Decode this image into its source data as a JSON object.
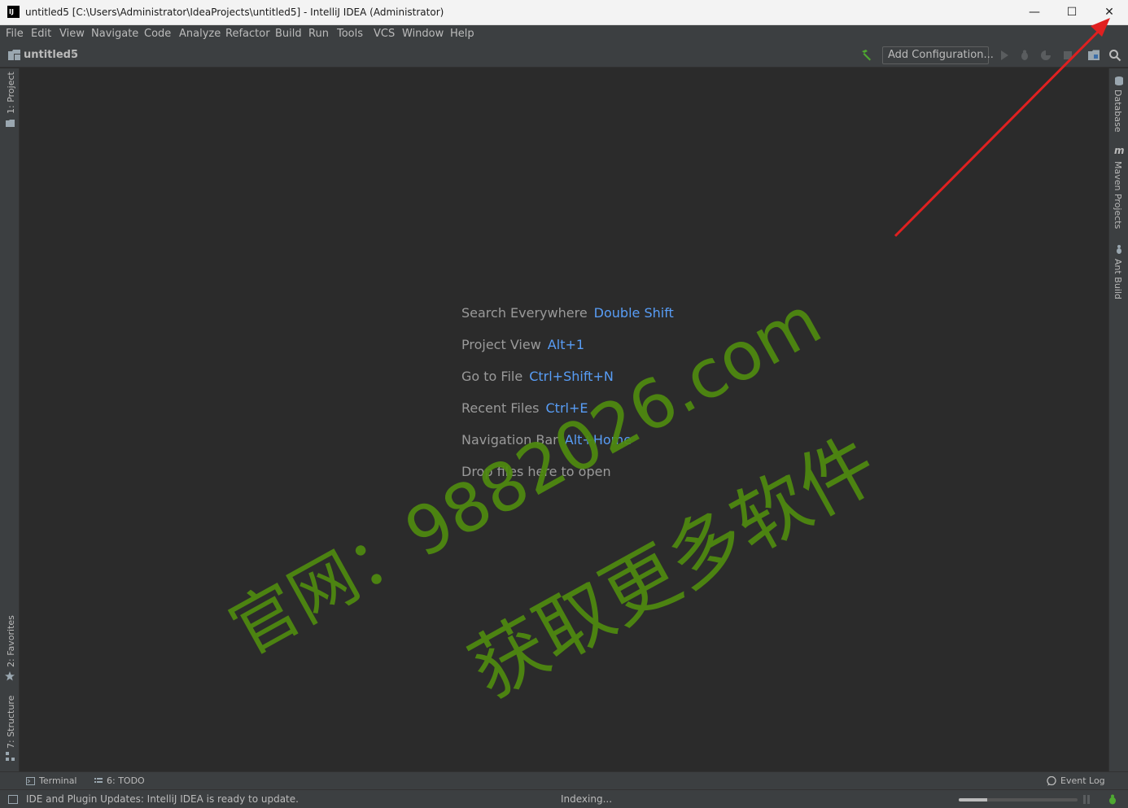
{
  "window": {
    "title": "untitled5 [C:\\Users\\Administrator\\IdeaProjects\\untitled5] - IntelliJ IDEA (Administrator)",
    "app_icon_text": "IJ",
    "controls": {
      "minimize": "—",
      "maximize": "☐",
      "close": "✕"
    }
  },
  "menu": [
    {
      "label": "File"
    },
    {
      "label": "Edit"
    },
    {
      "label": "View"
    },
    {
      "label": "Navigate"
    },
    {
      "label": "Code"
    },
    {
      "label": "Analyze"
    },
    {
      "label": "Refactor"
    },
    {
      "label": "Build"
    },
    {
      "label": "Run"
    },
    {
      "label": "Tools"
    },
    {
      "label": "VCS"
    },
    {
      "label": "Window"
    },
    {
      "label": "Help"
    }
  ],
  "navbar": {
    "project": "untitled5",
    "arrow": "›",
    "add_configuration": "Add Configuration..."
  },
  "left_tools": {
    "project": "1: Project",
    "favorites": "2: Favorites",
    "structure": "7: Structure"
  },
  "right_tools": {
    "database": "Database",
    "maven": "Maven Projects",
    "ant": "Ant Build"
  },
  "editor_hints": [
    {
      "label": "Search Everywhere",
      "shortcut": "Double Shift"
    },
    {
      "label": "Project View",
      "shortcut": "Alt+1"
    },
    {
      "label": "Go to File",
      "shortcut": "Ctrl+Shift+N"
    },
    {
      "label": "Recent Files",
      "shortcut": "Ctrl+E"
    },
    {
      "label": "Navigation Bar",
      "shortcut": "Alt+Home"
    },
    {
      "label": "Drop files here to open",
      "shortcut": ""
    }
  ],
  "bottom_tools": {
    "terminal": "Terminal",
    "todo": "6: TODO",
    "event_log": "Event Log"
  },
  "status": {
    "message": "IDE and Plugin Updates: IntelliJ IDEA is ready to update.",
    "indexing": "Indexing...",
    "progress": 0.24
  },
  "watermark": {
    "line1": "官网：9882026.com",
    "line2": "获取更多软件",
    "color": "#4f8a10"
  },
  "colors": {
    "accent_shortcut": "#589df6",
    "annotation_arrow": "#e02020",
    "build_hammer": "#4fa831"
  }
}
